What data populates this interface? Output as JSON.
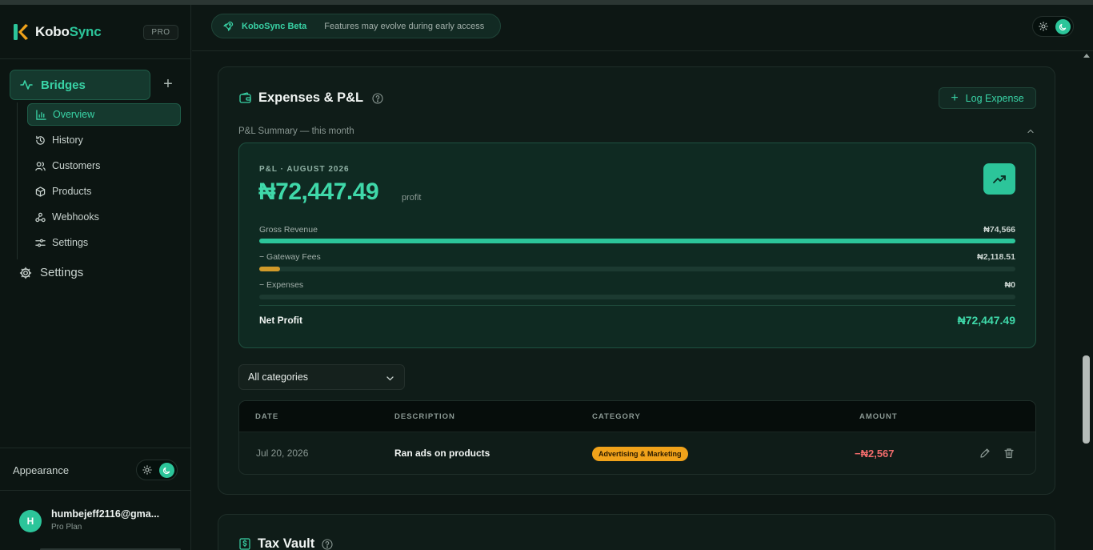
{
  "brand": {
    "name_prefix": "Kobo",
    "name_suffix": "Sync",
    "plan_badge": "PRO",
    "accent": "#2cc59a"
  },
  "sidebar": {
    "main_item": "Bridges",
    "sub_items": [
      {
        "label": "Overview",
        "icon": "bar-chart-icon",
        "active": true
      },
      {
        "label": "History",
        "icon": "history-icon"
      },
      {
        "label": "Customers",
        "icon": "users-icon"
      },
      {
        "label": "Products",
        "icon": "box-icon"
      },
      {
        "label": "Webhooks",
        "icon": "webhook-icon"
      },
      {
        "label": "Settings",
        "icon": "sliders-icon"
      }
    ],
    "settings_label": "Settings",
    "appearance_label": "Appearance",
    "user": {
      "initial": "H",
      "email": "humbejeff2116@gma...",
      "plan": "Pro Plan"
    }
  },
  "topbar": {
    "beta_title": "KoboSync Beta",
    "beta_desc": "Features may evolve during early access"
  },
  "expenses": {
    "title": "Expenses & P&L",
    "log_button": "Log Expense",
    "summary_label": "P&L Summary — this month",
    "pl": {
      "period": "P&L · AUGUST 2026",
      "amount": "₦72,447.49",
      "amount_suffix": "profit",
      "rows": [
        {
          "label": "Gross Revenue",
          "value": "₦74,566",
          "fraction": 1.0,
          "color": "#2cc59a"
        },
        {
          "label": "− Gateway Fees",
          "value": "₦2,118.51",
          "fraction": 0.028,
          "color": "#d19a2a"
        },
        {
          "label": "− Expenses",
          "value": "₦0",
          "fraction": 0,
          "color": "#d19a2a"
        }
      ],
      "net_label": "Net Profit",
      "net_value": "₦72,447.49"
    },
    "filter": {
      "selected": "All categories"
    },
    "table": {
      "columns": [
        "DATE",
        "DESCRIPTION",
        "CATEGORY",
        "AMOUNT"
      ],
      "rows": [
        {
          "date": "Jul 20, 2026",
          "description": "Ran ads on products",
          "category": "Advertising & Marketing",
          "amount": "−₦2,567"
        }
      ]
    }
  },
  "tax_vault": {
    "title": "Tax Vault"
  }
}
